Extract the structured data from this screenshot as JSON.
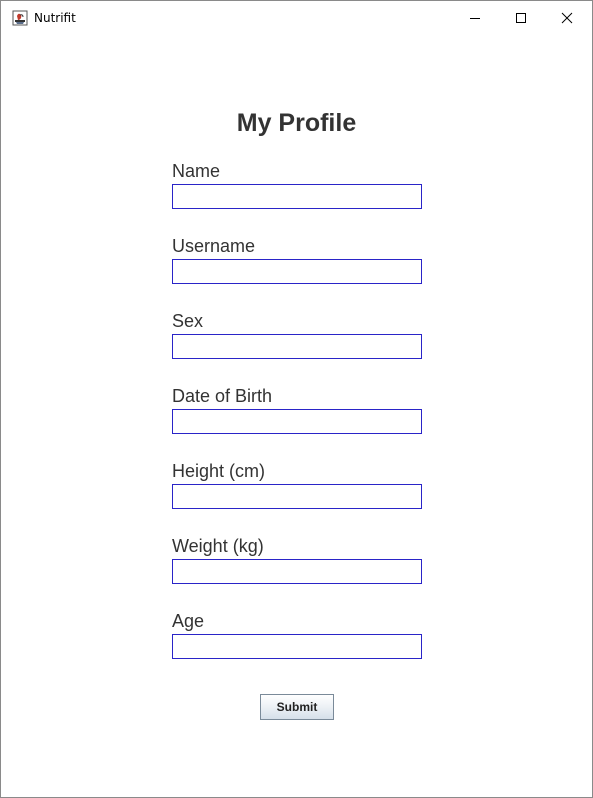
{
  "window": {
    "title": "Nutrifit",
    "app_icon": "java-coffee-icon",
    "controls": {
      "minimize_icon": "minimize-icon",
      "maximize_icon": "maximize-icon",
      "close_icon": "close-icon"
    }
  },
  "form": {
    "title": "My Profile",
    "fields": [
      {
        "label": "Name",
        "value": ""
      },
      {
        "label": "Username",
        "value": ""
      },
      {
        "label": "Sex",
        "value": ""
      },
      {
        "label": "Date of Birth",
        "value": ""
      },
      {
        "label": "Height (cm)",
        "value": ""
      },
      {
        "label": "Weight (kg)",
        "value": ""
      },
      {
        "label": "Age",
        "value": ""
      }
    ],
    "submit_label": "Submit"
  },
  "colors": {
    "input_border": "#2a24c8",
    "text": "#333333",
    "background": "#ffffff"
  }
}
